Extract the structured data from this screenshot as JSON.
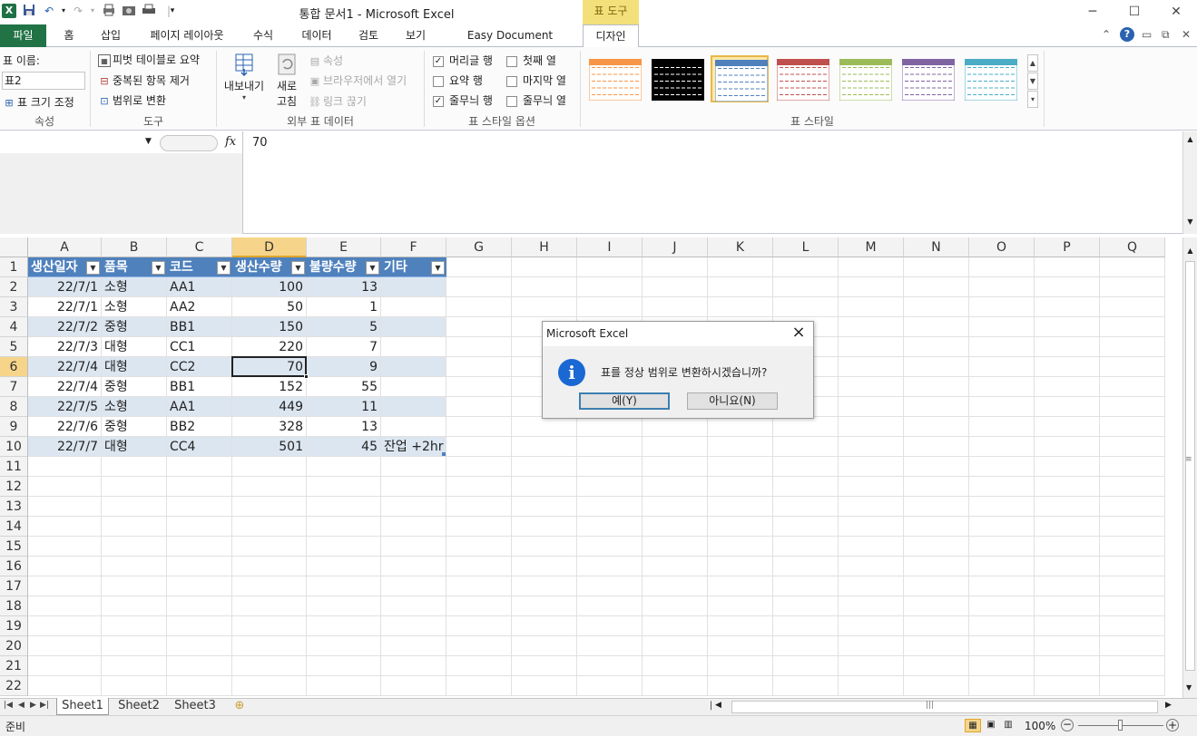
{
  "window": {
    "title": "통합 문서1  -  Microsoft Excel",
    "context_group": "표 도구",
    "controls": [
      "─",
      "☐",
      "✕"
    ]
  },
  "tabs": {
    "file": "파일",
    "items": [
      "홈",
      "삽입",
      "페이지 레이아웃",
      "수식",
      "데이터",
      "검토",
      "보기",
      "Easy Document Creator"
    ],
    "design": "디자인"
  },
  "ribbon": {
    "properties": {
      "caption": "속성",
      "table_name_label": "표 이름:",
      "table_name_value": "표2",
      "resize_label": "표 크기 조정"
    },
    "tools": {
      "caption": "도구",
      "pivot": "피벗 테이블로 요약",
      "remove_duplicates": "중복된 항목 제거",
      "convert_range": "범위로 변환"
    },
    "external": {
      "caption": "외부 표 데이터",
      "export": "내보내기",
      "refresh_line1": "새로",
      "refresh_line2": "고침",
      "properties": "속성",
      "open_browser": "브라우저에서 열기",
      "unlink": "링크 끊기"
    },
    "style_options": {
      "caption": "표 스타일 옵션",
      "header_row": "머리글 행",
      "total_row": "요약 행",
      "banded_rows": "줄무늬 행",
      "first_column": "첫째 열",
      "last_column": "마지막 열",
      "banded_columns": "줄무늬 열",
      "checked": {
        "header_row": true,
        "total_row": false,
        "banded_rows": true,
        "first_column": false,
        "last_column": false,
        "banded_columns": false
      }
    },
    "styles": {
      "caption": "표 스타일",
      "swatch_colors": [
        "#f79646",
        "#000000",
        "#4f81bd",
        "#c0504d",
        "#9bbb59",
        "#8064a2",
        "#4bacc6"
      ],
      "selected_index": 2
    }
  },
  "formula_bar": {
    "fx": "fx",
    "value": "70"
  },
  "grid": {
    "columns": [
      "A",
      "B",
      "C",
      "D",
      "E",
      "F",
      "G",
      "H",
      "I",
      "J",
      "K",
      "L",
      "M",
      "N",
      "O",
      "P",
      "Q"
    ],
    "active_column": "D",
    "rows": [
      "1",
      "2",
      "3",
      "4",
      "5",
      "6",
      "7",
      "8",
      "9",
      "10",
      "11",
      "12",
      "13",
      "14",
      "15",
      "16",
      "17",
      "18",
      "19",
      "20",
      "21",
      "22"
    ],
    "active_row": "6",
    "table_headers": [
      "생산일자",
      "품목",
      "코드",
      "생산수량",
      "불량수량",
      "기타"
    ],
    "table_rows": [
      [
        "22/7/1",
        "소형",
        "AA1",
        "100",
        "13",
        ""
      ],
      [
        "22/7/1",
        "소형",
        "AA2",
        "50",
        "1",
        ""
      ],
      [
        "22/7/2",
        "중형",
        "BB1",
        "150",
        "5",
        ""
      ],
      [
        "22/7/3",
        "대형",
        "CC1",
        "220",
        "7",
        ""
      ],
      [
        "22/7/4",
        "대형",
        "CC2",
        "70",
        "9",
        ""
      ],
      [
        "22/7/4",
        "중형",
        "BB1",
        "152",
        "55",
        ""
      ],
      [
        "22/7/5",
        "소형",
        "AA1",
        "449",
        "11",
        ""
      ],
      [
        "22/7/6",
        "중형",
        "BB2",
        "328",
        "13",
        ""
      ],
      [
        "22/7/7",
        "대형",
        "CC4",
        "501",
        "45",
        "잔업  +2hr"
      ]
    ],
    "header_color": "#4f81bd",
    "band_color": "#dce6f1"
  },
  "sheets": {
    "tabs": [
      "Sheet1",
      "Sheet2",
      "Sheet3"
    ],
    "active": "Sheet1"
  },
  "status": {
    "ready": "준비",
    "zoom": "100%"
  },
  "dialog": {
    "title": "Microsoft Excel",
    "message": "표를 정상 범위로 변환하시겠습니까?",
    "yes": "예(Y)",
    "no": "아니요(N)",
    "icon": "info-icon"
  }
}
